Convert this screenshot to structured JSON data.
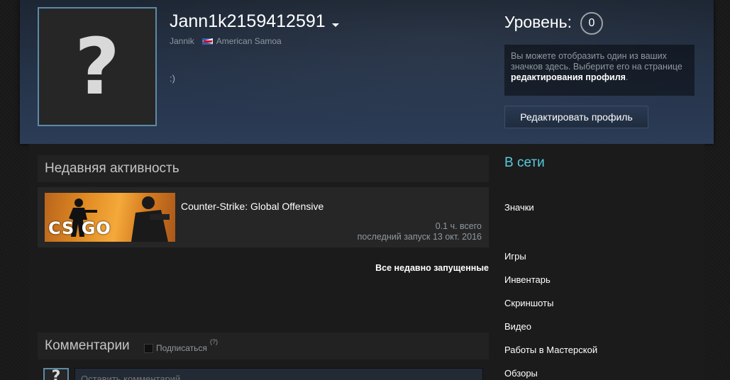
{
  "profile": {
    "persona_name": "Jann1k2159412591",
    "real_name": "Jannik",
    "country": "American Samoa",
    "summary": ":)",
    "avatar_glyph": "?"
  },
  "level": {
    "label": "Уровень:",
    "value": "0"
  },
  "badge_hint": {
    "text_before": "Вы можете отобразить один из ваших значков здесь. Выберите его на странице ",
    "link": "редактирования профиля",
    "text_after": "."
  },
  "buttons": {
    "edit_profile": "Редактировать профиль"
  },
  "recent_activity": {
    "title": "Недавняя активность",
    "games": [
      {
        "name": "Counter-Strike: Global Offensive",
        "logo_text": "CS GO",
        "hours": "0.1 ч. всего",
        "last_played": "последний запуск 13 окт. 2016"
      }
    ],
    "all_recent_link": "Все недавно запущенные"
  },
  "comments": {
    "title": "Комментарии",
    "subscribe_label": "Подписаться",
    "help_mark": "(?)",
    "input_placeholder": "Оставить комментарий..."
  },
  "sidebar": {
    "status": "В сети",
    "links": [
      "Значки",
      "Игры",
      "Инвентарь",
      "Скриншоты",
      "Видео",
      "Работы в Мастерской",
      "Обзоры"
    ]
  },
  "colors": {
    "accent_online": "#57cbde",
    "avatar_border": "#5d8aa8",
    "header_bg": "#26344a"
  }
}
